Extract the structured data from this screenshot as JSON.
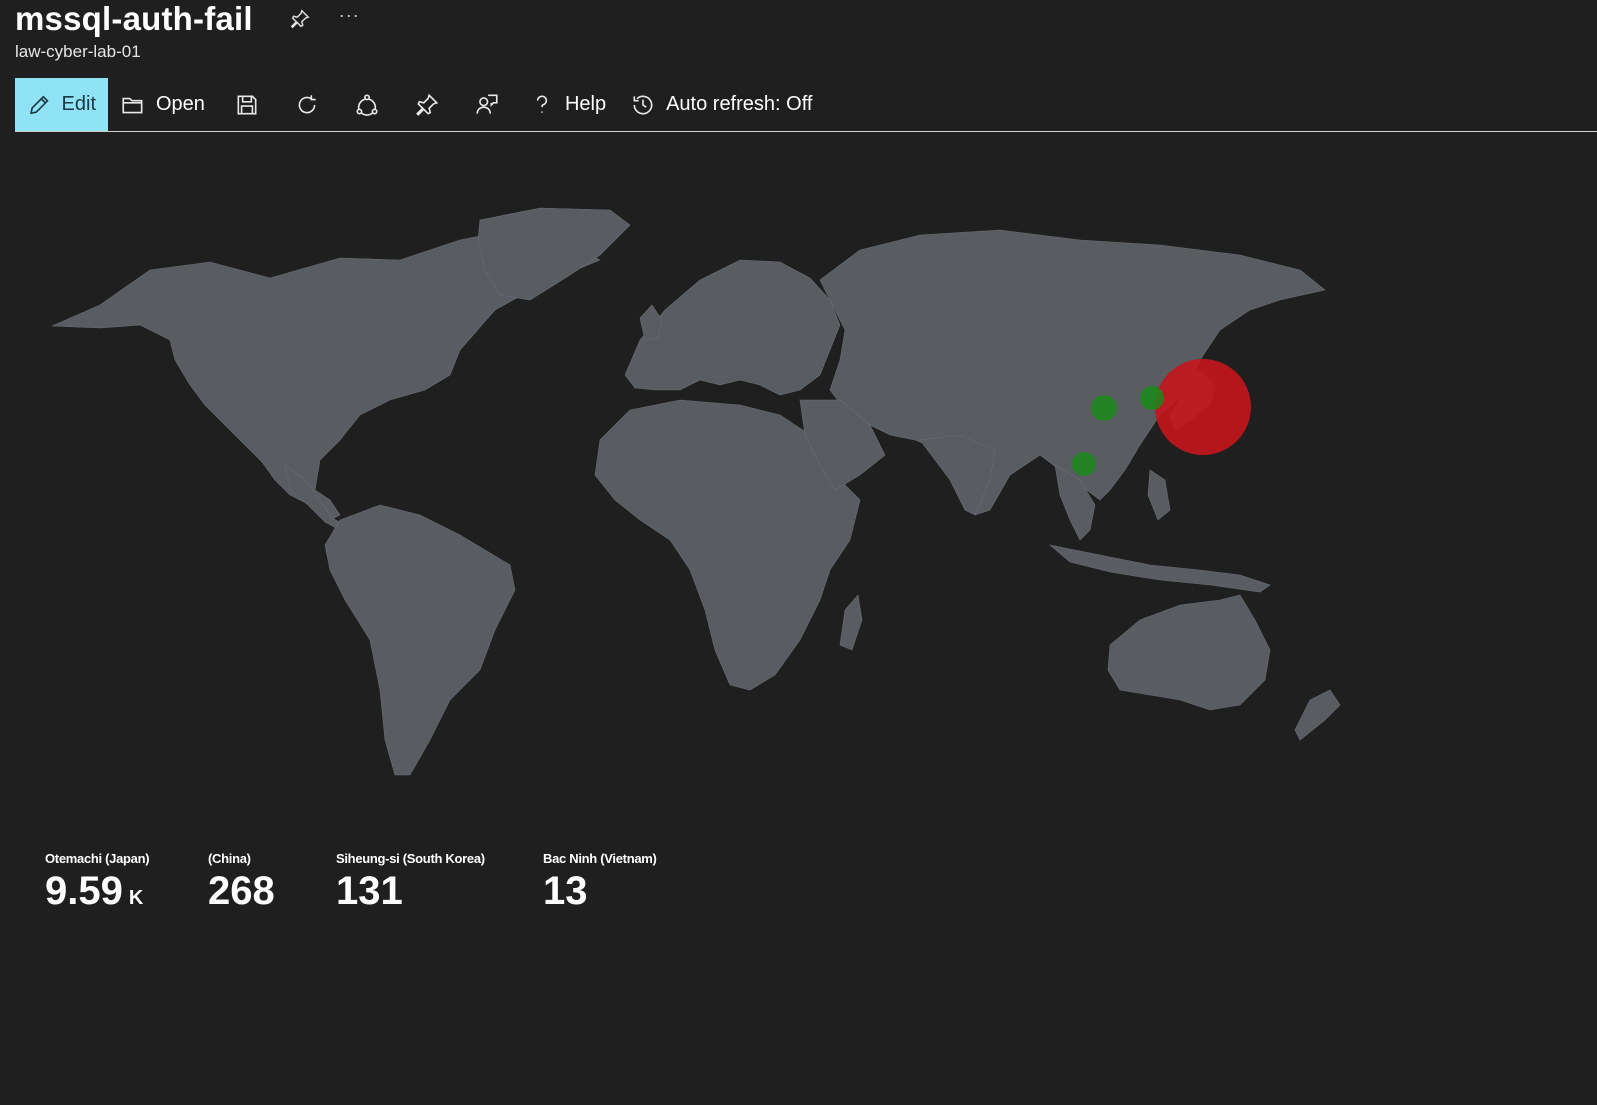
{
  "header": {
    "title": "mssql-auth-fail",
    "more": "···",
    "subtitle": "law-cyber-lab-01"
  },
  "toolbar": {
    "edit_label": "Edit",
    "open_label": "Open",
    "help_label": "Help",
    "auto_refresh_label": "Auto refresh: Off"
  },
  "map": {
    "land_color": "#595c61",
    "background": "#1f1f1f",
    "bubbles": [
      {
        "location": "Otemachi (Japan)",
        "value": 9590,
        "color": "#c4151c"
      },
      {
        "location": "(China)",
        "value": 268,
        "color": "#1a8a1a"
      },
      {
        "location": "Siheung-si (South Korea)",
        "value": 131,
        "color": "#1a8a1a"
      },
      {
        "location": "Bac Ninh (Vietnam)",
        "value": 13,
        "color": "#1a8a1a"
      }
    ]
  },
  "stats": [
    {
      "location": "Otemachi (Japan)",
      "value": "9.59",
      "unit": "K"
    },
    {
      "location": "(China)",
      "value": "268",
      "unit": ""
    },
    {
      "location": "Siheung-si (South Korea)",
      "value": "131",
      "unit": ""
    },
    {
      "location": "Bac Ninh (Vietnam)",
      "value": "13",
      "unit": ""
    }
  ]
}
